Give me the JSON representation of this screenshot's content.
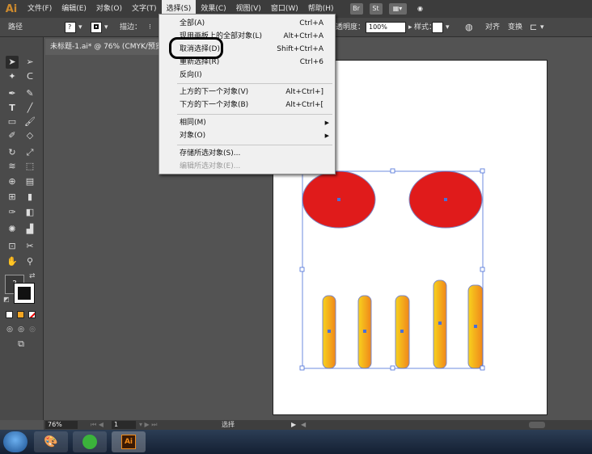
{
  "app": {
    "logo": "Ai"
  },
  "menubar": {
    "items": [
      "文件(F)",
      "编辑(E)",
      "对象(O)",
      "文字(T)",
      "选择(S)",
      "效果(C)",
      "视图(V)",
      "窗口(W)",
      "帮助(H)"
    ],
    "right_buttons": [
      "Br",
      "St"
    ]
  },
  "controlbar": {
    "path_label": "路径",
    "stroke_label": "描边：",
    "opacity_label": "透明度：",
    "opacity_value": "100%",
    "style_label": "样式：",
    "align_label": "对齐",
    "transform_label": "变换",
    "unknown_glyph": "?"
  },
  "document": {
    "tab_title": "未标题-1.ai* @ 76% (CMYK/预览"
  },
  "dropdown": {
    "items": [
      {
        "label": "全部(A)",
        "shortcut": "Ctrl+A"
      },
      {
        "label": "现用画板上的全部对象(L)",
        "shortcut": "Alt+Ctrl+A"
      },
      {
        "label": "取消选择(D)",
        "shortcut": "Shift+Ctrl+A"
      },
      {
        "label": "重新选择(R)",
        "shortcut": "Ctrl+6"
      },
      {
        "label": "反向(I)",
        "shortcut": ""
      },
      {
        "label": "上方的下一个对象(V)",
        "shortcut": "Alt+Ctrl+]"
      },
      {
        "label": "下方的下一个对象(B)",
        "shortcut": "Alt+Ctrl+["
      },
      {
        "label": "相同(M)",
        "shortcut": ""
      },
      {
        "label": "对象(O)",
        "shortcut": ""
      },
      {
        "label": "存储所选对象(S)...",
        "shortcut": ""
      },
      {
        "label": "编辑所选对象(E)...",
        "shortcut": ""
      }
    ]
  },
  "statusbar": {
    "zoom": "76%",
    "page": "1",
    "status_text": "选择"
  },
  "toolbar": {
    "fill_stroke_glyph": "?"
  },
  "colors": {
    "ellipse_fill": "#e01b1b",
    "bar_top": "#f7c816",
    "bar_bottom": "#f08a1a",
    "selection": "#4a6fd8",
    "menu_bg": "#f0f0f0"
  }
}
